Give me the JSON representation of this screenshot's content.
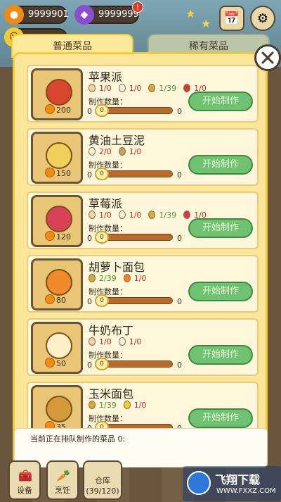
{
  "hud": {
    "coins": "9999901",
    "gems": "9999999",
    "gem_badge": "!",
    "coin_badge": "!"
  },
  "tabs": {
    "normal": "普通菜品",
    "rare": "稀有菜品"
  },
  "common": {
    "qty_label": "制作数量：",
    "make_label": "开始制作",
    "slider_value": "0",
    "slider_min": "0",
    "slider_max": "0"
  },
  "dishes": [
    {
      "name": "苹果派",
      "price": "200",
      "ingredients": [
        {
          "icon": "egg-icon",
          "text": "1/0",
          "color": "red"
        },
        {
          "icon": "milk-bottle-icon",
          "text": "1/0",
          "color": "red"
        },
        {
          "icon": "wheat-icon",
          "text": "1/39",
          "color": "green"
        },
        {
          "icon": "apple-icon",
          "text": "1/0",
          "color": "red"
        }
      ]
    },
    {
      "name": "黄油土豆泥",
      "price": "150",
      "ingredients": [
        {
          "icon": "milk-bottle-icon",
          "text": "2/0",
          "color": "red"
        },
        {
          "icon": "potato-icon",
          "text": "1/0",
          "color": "red"
        }
      ]
    },
    {
      "name": "草莓派",
      "price": "120",
      "ingredients": [
        {
          "icon": "egg-icon",
          "text": "1/0",
          "color": "red"
        },
        {
          "icon": "milk-bottle-icon",
          "text": "1/0",
          "color": "red"
        },
        {
          "icon": "wheat-icon",
          "text": "1/39",
          "color": "green"
        },
        {
          "icon": "strawberry-icon",
          "text": "1/0",
          "color": "red"
        }
      ]
    },
    {
      "name": "胡萝卜面包",
      "price": "80",
      "ingredients": [
        {
          "icon": "wheat-icon",
          "text": "2/39",
          "color": "green"
        },
        {
          "icon": "carrot-icon",
          "text": "1/0",
          "color": "red"
        }
      ]
    },
    {
      "name": "牛奶布丁",
      "price": "50",
      "ingredients": [
        {
          "icon": "egg-icon",
          "text": "1/0",
          "color": "red"
        },
        {
          "icon": "milk-bottle-icon",
          "text": "1/0",
          "color": "red"
        }
      ]
    },
    {
      "name": "玉米面包",
      "price": "35",
      "ingredients": [
        {
          "icon": "wheat-icon",
          "text": "1/39",
          "color": "green"
        },
        {
          "icon": "corn-icon",
          "text": "1/0",
          "color": "red"
        }
      ]
    }
  ],
  "queue": {
    "text": "当前正在排队制作的菜品 0:"
  },
  "bottom": {
    "equipment": "设备",
    "cooking": "烹饪",
    "warehouse": "仓库",
    "warehouse_count": "(39/120)"
  },
  "watermark": {
    "title": "飞翔下载",
    "url": "WWW.FXXZ.COM"
  },
  "colors": {
    "red": "#c8261b",
    "green": "#3f9a2f",
    "button": "#6fc271",
    "panel": "#fbe699"
  }
}
